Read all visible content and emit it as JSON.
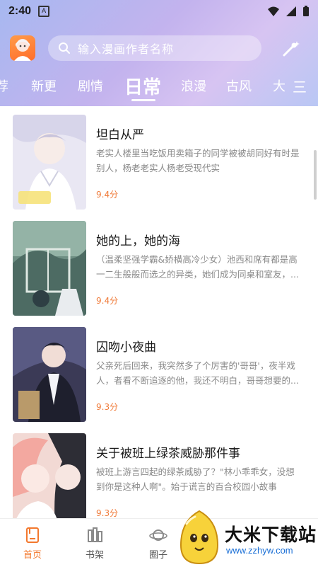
{
  "status_bar": {
    "time": "2:40",
    "notification_glyph": "A"
  },
  "search": {
    "placeholder": "输入漫画作者名称"
  },
  "tabs": [
    {
      "label": "荐"
    },
    {
      "label": "新更"
    },
    {
      "label": "剧情"
    },
    {
      "label": "日常",
      "active": true
    },
    {
      "label": "浪漫"
    },
    {
      "label": "古风"
    },
    {
      "label": "大"
    }
  ],
  "tab_menu_icon": "三",
  "comics": [
    {
      "title": "坦白从严",
      "description": "老实人楼里当吃饭用卖箱子的同学被被胡同好有时是别人，杨老老实人杨老受现代实",
      "score": "9.4分"
    },
    {
      "title": "她的上，她的海",
      "description": "（温柔坚强学霸&娇横高冷少女）池西和席有都是高一二生般般而选之的异类，她们成为同桌和室友，...",
      "score": "9.4分"
    },
    {
      "title": "囚吻小夜曲",
      "description": "父亲死后回来，我突然多了个厉害的'哥哥'，夜半戏人，者看不断追逐的他，我还不明白，哥哥想要的...",
      "score": "9.3分"
    },
    {
      "title": "关于被班上绿茶威胁那件事",
      "description": "被班上游言四起的绿茶威胁了？\"林小乖乖女，没想到你是这种人啊\"。始于谎言的百合校园小故事",
      "score": "9.3分"
    }
  ],
  "bottom_nav": [
    {
      "label": "首页",
      "active": true
    },
    {
      "label": "书架"
    },
    {
      "label": "圈子"
    }
  ],
  "watermark": {
    "title": "大米下载站",
    "url": "www.zzhyw.com"
  },
  "colors": {
    "accent": "#f3782d",
    "score": "#f07b3a",
    "header_start": "#a7b8f0",
    "header_end": "#d7c4f2"
  }
}
